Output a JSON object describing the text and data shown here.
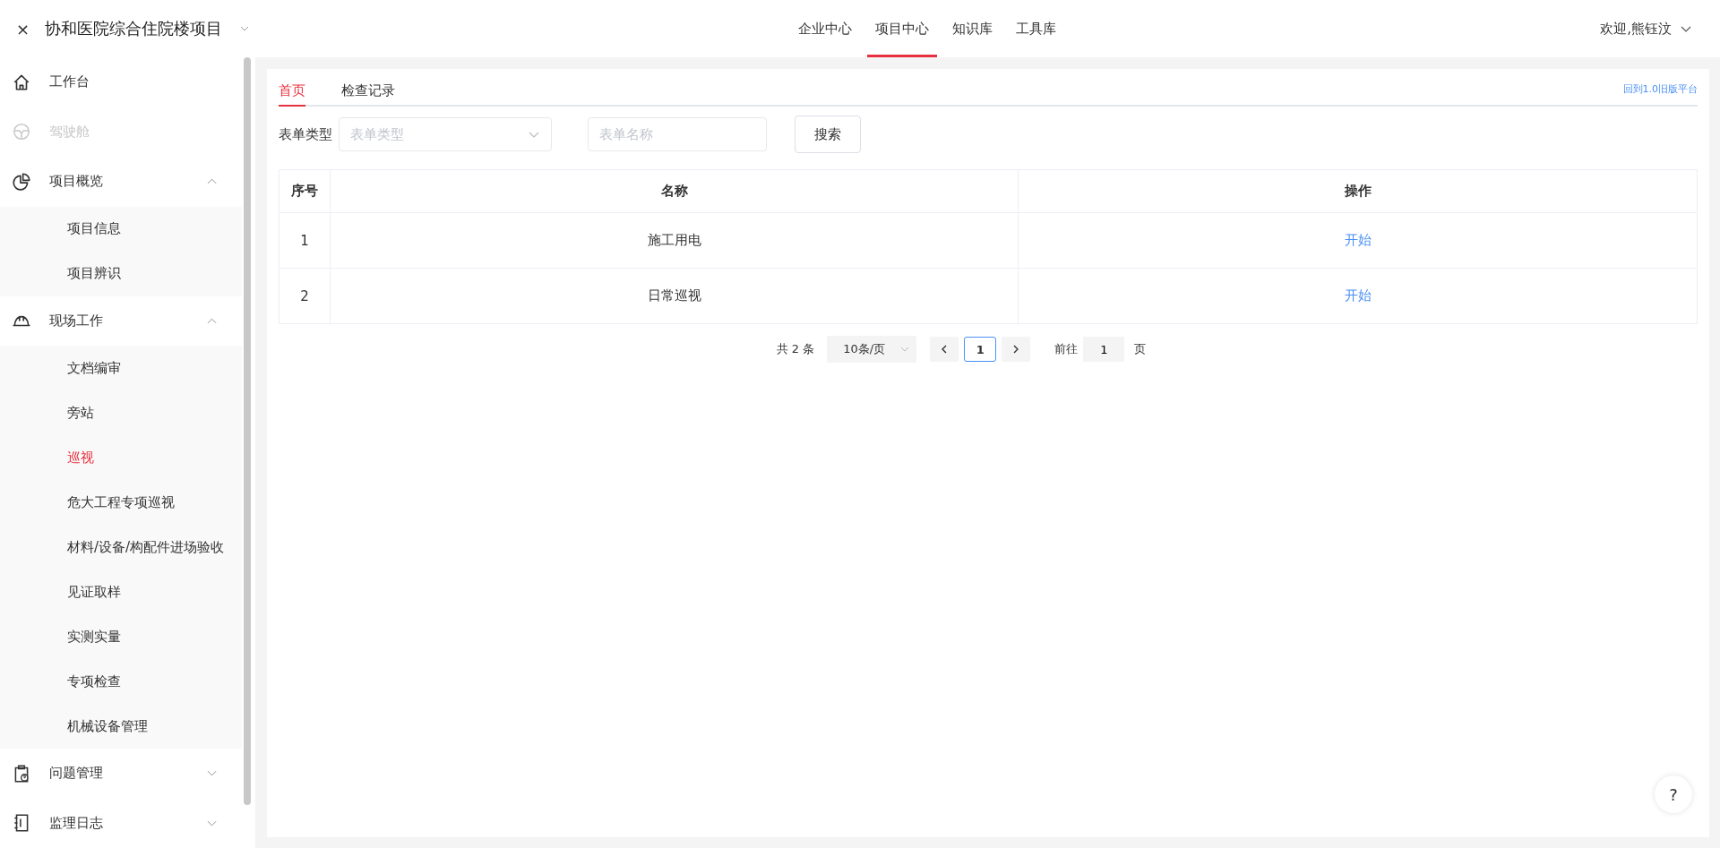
{
  "header": {
    "close": "×",
    "project": "协和医院综合住院楼项目",
    "nav": [
      {
        "label": "企业中心",
        "selected": false
      },
      {
        "label": "项目中心",
        "selected": true
      },
      {
        "label": "知识库",
        "selected": false
      },
      {
        "label": "工具库",
        "selected": false
      }
    ],
    "user": "欢迎,熊钰汶"
  },
  "sidebar": {
    "items": [
      {
        "label": "工作台",
        "disabled": false
      },
      {
        "label": "驾驶舱",
        "disabled": true
      },
      {
        "label": "项目概览",
        "disabled": false,
        "expanded": true,
        "children": [
          {
            "label": "项目信息",
            "selected": false
          },
          {
            "label": "项目辨识",
            "selected": false
          }
        ]
      },
      {
        "label": "现场工作",
        "disabled": false,
        "expanded": true,
        "children": [
          {
            "label": "文档编审",
            "selected": false
          },
          {
            "label": "旁站",
            "selected": false
          },
          {
            "label": "巡视",
            "selected": true
          },
          {
            "label": "危大工程专项巡视",
            "selected": false
          },
          {
            "label": "材料/设备/构配件进场验收",
            "selected": false
          },
          {
            "label": "见证取样",
            "selected": false
          },
          {
            "label": "实测实量",
            "selected": false
          },
          {
            "label": "专项检查",
            "selected": false
          },
          {
            "label": "机械设备管理",
            "selected": false
          }
        ]
      },
      {
        "label": "问题管理",
        "disabled": false,
        "expanded": false
      },
      {
        "label": "监理日志",
        "disabled": false,
        "expanded": false
      }
    ]
  },
  "tabs": [
    {
      "label": "首页",
      "selected": true
    },
    {
      "label": "检查记录",
      "selected": false
    }
  ],
  "old_platform_link": "回到1.0旧版平台",
  "filters": {
    "type_label": "表单类型",
    "type_placeholder": "表单类型",
    "name_placeholder": "表单名称",
    "search_button": "搜索"
  },
  "table": {
    "columns": [
      "序号",
      "名称",
      "操作"
    ],
    "rows": [
      {
        "index": "1",
        "name": "施工用电",
        "action": "开始"
      },
      {
        "index": "2",
        "name": "日常巡视",
        "action": "开始"
      }
    ]
  },
  "pagination": {
    "total": "共 2 条",
    "page_size": "10条/页",
    "pages": [
      {
        "label": "1",
        "selected": true
      }
    ],
    "goto_label": "前往",
    "goto_value": "1",
    "goto_suffix": "页"
  },
  "help_button": "?"
}
